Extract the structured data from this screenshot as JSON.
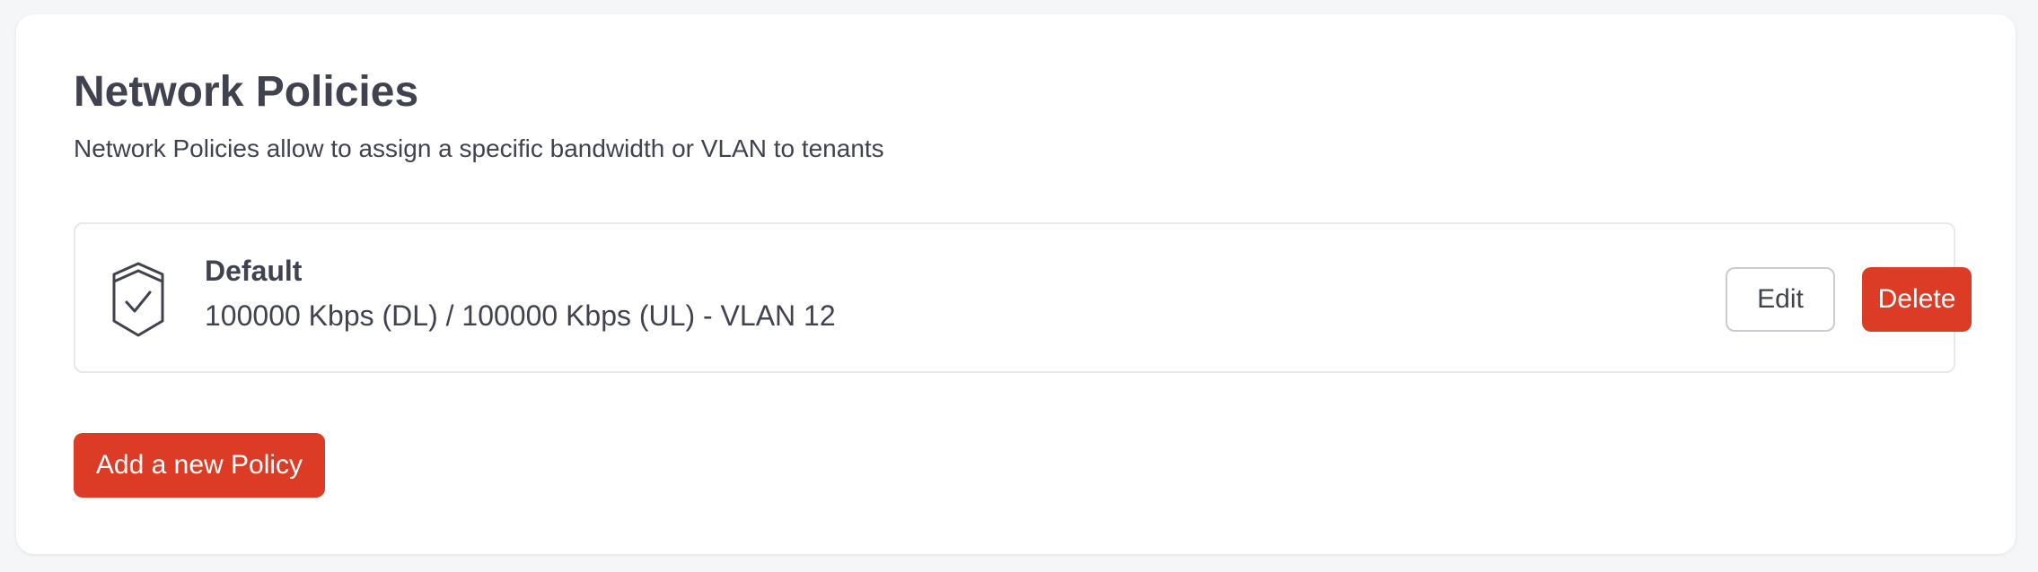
{
  "header": {
    "title": "Network Policies",
    "subtitle": "Network Policies allow to assign a specific bandwidth or VLAN to tenants"
  },
  "policies": [
    {
      "icon": "shield-check-icon",
      "name": "Default",
      "details": "100000 Kbps (DL) / 100000 Kbps (UL) - VLAN 12",
      "edit_label": "Edit",
      "delete_label": "Delete"
    }
  ],
  "actions": {
    "add_label": "Add a new Policy"
  },
  "colors": {
    "accent": "#dc3b26",
    "text": "#40434f",
    "background": "#f5f6f8",
    "card": "#ffffff",
    "border": "#e7e8ec"
  }
}
